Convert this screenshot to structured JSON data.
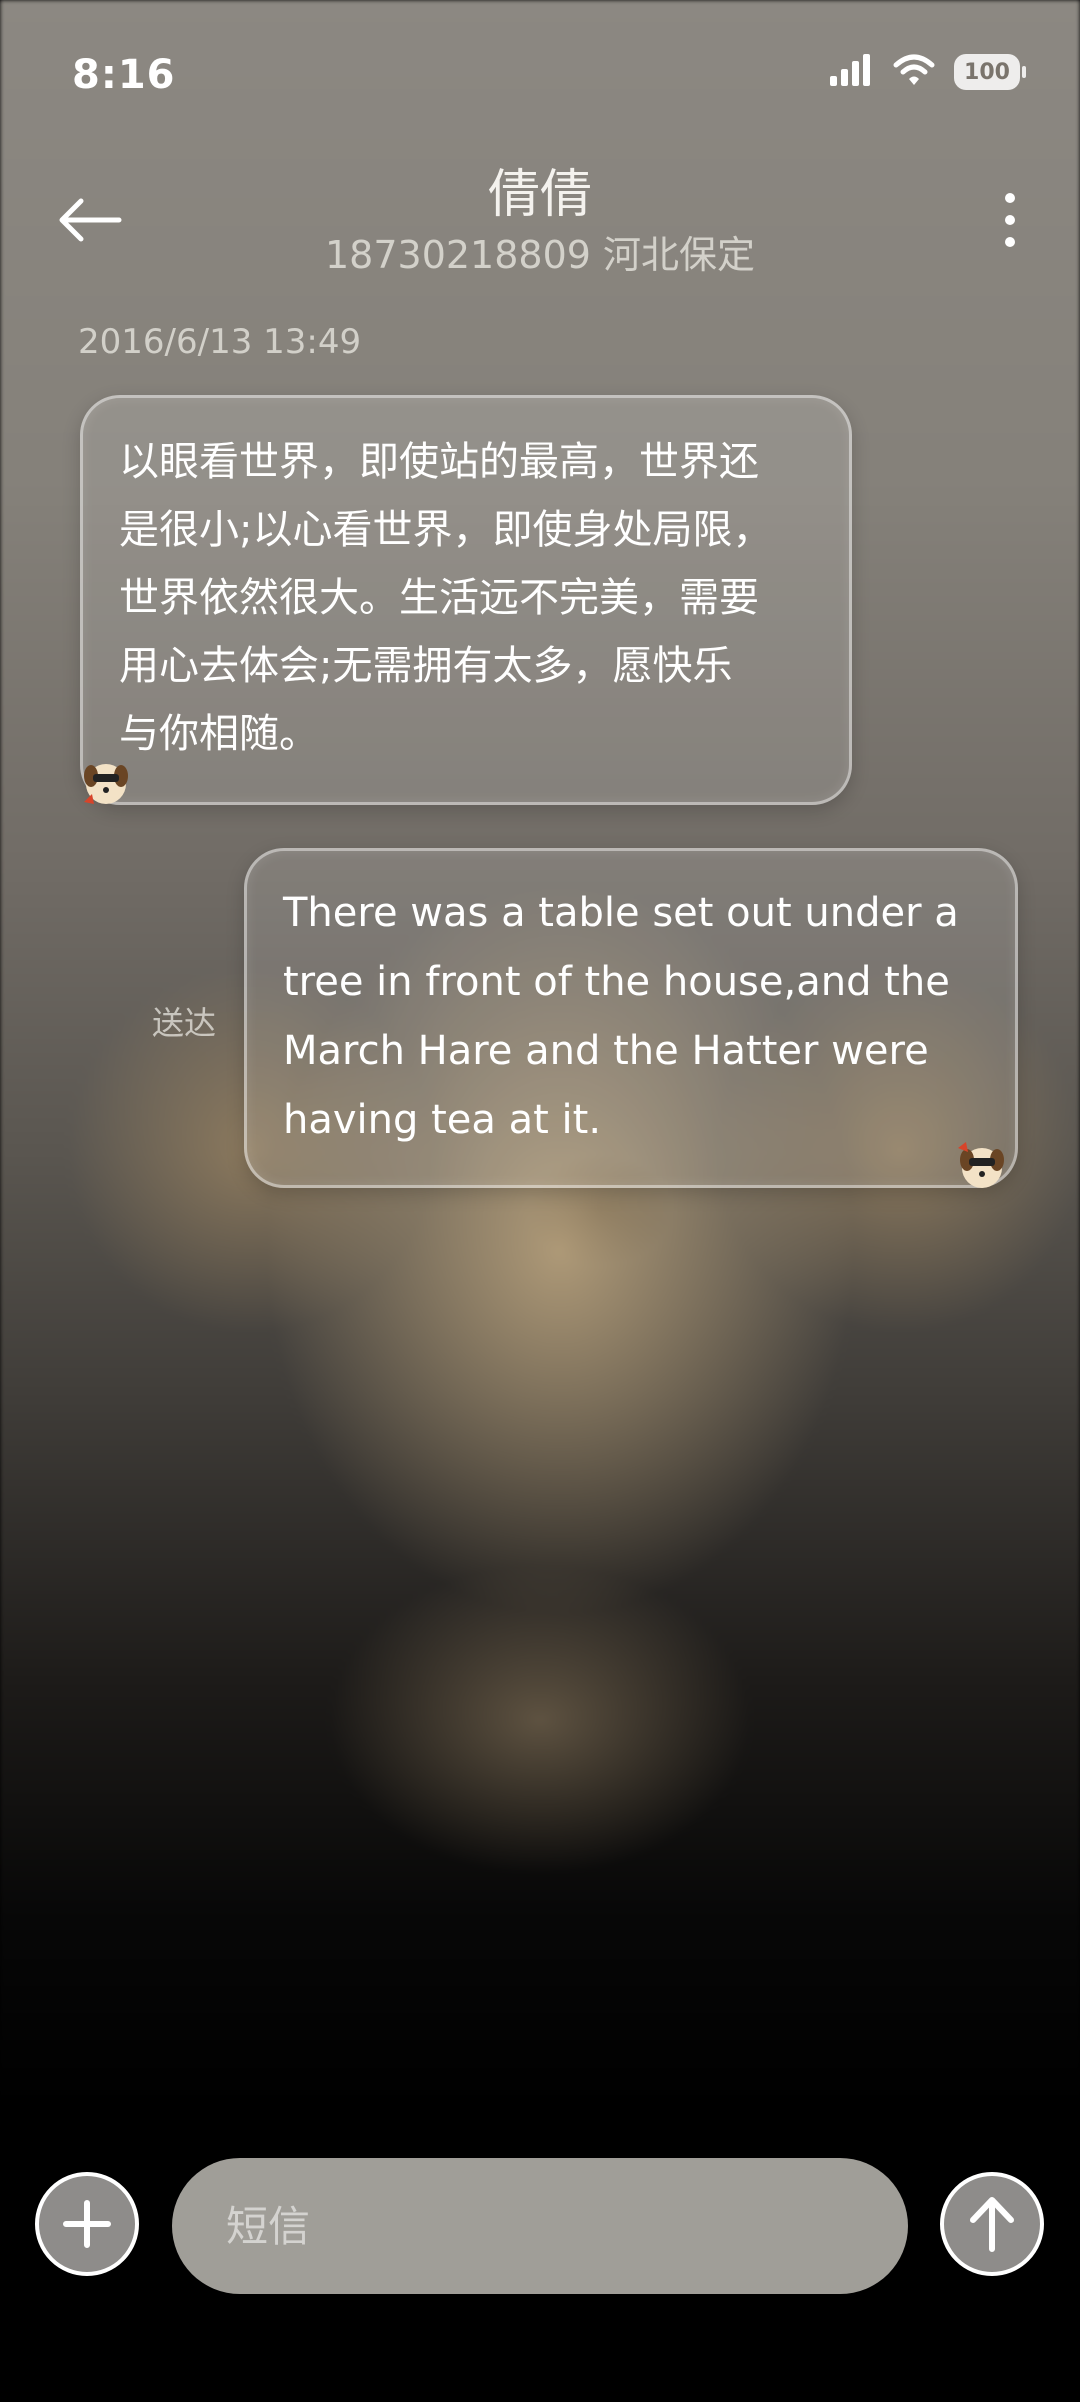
{
  "status_bar": {
    "time": "8:16",
    "battery": "100",
    "icons": [
      "signal-icon",
      "wifi-icon",
      "battery-icon"
    ]
  },
  "header": {
    "contact_name": "倩倩",
    "contact_info": "18730218809 河北保定",
    "back_icon": "arrow-left-icon",
    "more_icon": "more-vertical-icon"
  },
  "thread": {
    "date": "2016/6/13 13:49",
    "messages": [
      {
        "direction": "incoming",
        "lines": [
          "以眼看世界，即使站的最高，世界还",
          "是很小;以心看世界，即使身处局限，",
          "世界依然很大。生活远不完美，需要",
          "用心去体会;无需拥有太多，愿快乐",
          "与你相随。"
        ]
      },
      {
        "direction": "outgoing",
        "status": "送达",
        "lines": [
          "There was a table set out under a",
          "tree in front of the house,and the",
          "March Hare and the Hatter were",
          "having tea at it."
        ]
      }
    ]
  },
  "composer": {
    "placeholder": "短信",
    "value": "",
    "add_icon": "plus-icon",
    "send_icon": "arrow-up-icon"
  },
  "colors": {
    "bubble_border": "#ffffff",
    "input_bg": "#a09e98",
    "button_bg": "#8e8c8a"
  }
}
